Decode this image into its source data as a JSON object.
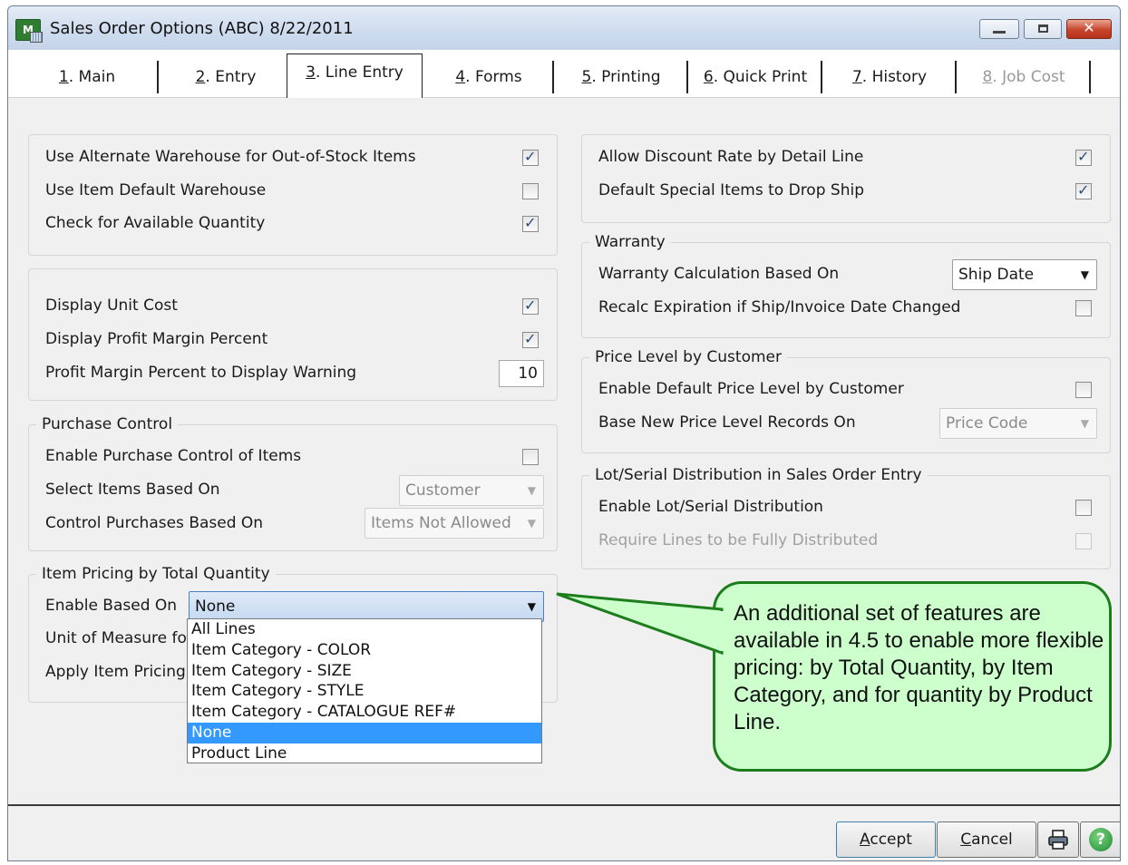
{
  "window": {
    "title": "Sales Order Options (ABC) 8/22/2011",
    "icon_text": "M"
  },
  "tabs": [
    {
      "key": "1",
      "rest": ". Main",
      "active": false,
      "disabled": false
    },
    {
      "key": "2",
      "rest": ". Entry",
      "active": false,
      "disabled": false
    },
    {
      "key": "3",
      "rest": ". Line Entry",
      "active": true,
      "disabled": false
    },
    {
      "key": "4",
      "rest": ". Forms",
      "active": false,
      "disabled": false
    },
    {
      "key": "5",
      "rest": ". Printing",
      "active": false,
      "disabled": false
    },
    {
      "key": "6",
      "rest": ". Quick Print",
      "active": false,
      "disabled": false
    },
    {
      "key": "7",
      "rest": ". History",
      "active": false,
      "disabled": false
    },
    {
      "key": "8",
      "rest": ". Job Cost",
      "active": false,
      "disabled": true
    }
  ],
  "warehouse_panel": {
    "alt_warehouse_label": "Use Alternate Warehouse for Out-of-Stock Items",
    "item_default_warehouse_label": "Use Item Default Warehouse",
    "check_qty_label": "Check for Available Quantity"
  },
  "cost_panel": {
    "unit_cost_label": "Display Unit Cost",
    "profit_margin_label": "Display Profit Margin Percent",
    "warning_label": "Profit Margin Percent to Display Warning",
    "warning_value": "10"
  },
  "purchase_control": {
    "title": "Purchase Control",
    "enable_label": "Enable Purchase Control of Items",
    "select_label": "Select Items Based On",
    "select_value": "Customer",
    "control_label": "Control Purchases Based On",
    "control_value": "Items Not Allowed"
  },
  "item_pricing": {
    "title": "Item Pricing by Total Quantity",
    "enable_label": "Enable Based On",
    "enable_value": "None",
    "uom_label": "Unit of Measure for",
    "apply_label": "Apply Item Pricing A",
    "options": [
      "All Lines",
      "Item Category - COLOR",
      "Item Category - SIZE",
      "Item Category - STYLE",
      "Item Category - CATALOGUE REF#",
      "None",
      "Product Line"
    ],
    "selected_option": "None"
  },
  "discount_panel": {
    "discount_label": "Allow Discount Rate by Detail Line",
    "drop_ship_label": "Default Special Items to Drop Ship"
  },
  "warranty": {
    "title": "Warranty",
    "calc_label": "Warranty Calculation Based On",
    "calc_value": "Ship Date",
    "recalc_label": "Recalc Expiration if Ship/Invoice Date Changed"
  },
  "price_level": {
    "title": "Price Level by Customer",
    "enable_label": "Enable Default Price Level by Customer",
    "base_label": "Base New Price Level Records On",
    "base_value": "Price Code"
  },
  "lot_serial": {
    "title": "Lot/Serial Distribution in Sales Order Entry",
    "enable_label": "Enable Lot/Serial Distribution",
    "require_label": "Require Lines to be Fully Distributed"
  },
  "callout": {
    "text": "An additional set of features are available in 4.5 to enable more flexible pricing: by Total Quantity, by Item Category, and for quantity by Product Line."
  },
  "buttons": {
    "accept_key": "A",
    "accept_rest": "ccept",
    "cancel_key": "C",
    "cancel_rest": "ancel",
    "help_glyph": "?"
  },
  "colors": {
    "callout_fill": "#ccffcc",
    "callout_border": "#1d7d1d",
    "selection": "#3399ff"
  }
}
